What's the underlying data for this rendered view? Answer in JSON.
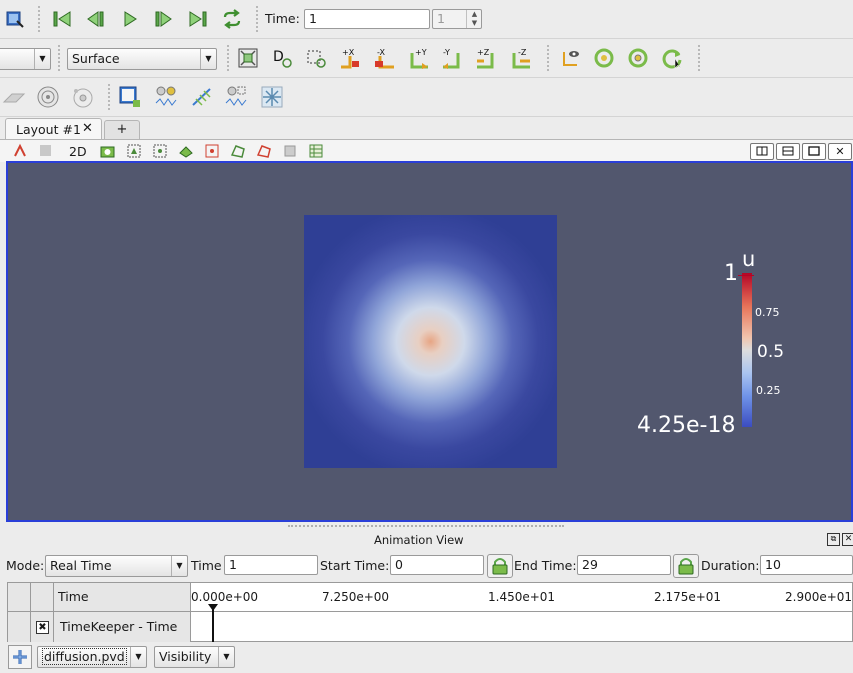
{
  "toolbar_vcr": {
    "time_label": "Time:",
    "time_value": "1",
    "timestep_value": "1"
  },
  "toolbar_representation": {
    "representation": "Surface",
    "camera_labels": [
      "+X",
      "-X",
      "+Y",
      "-Y",
      "+Z",
      "-Z"
    ]
  },
  "tabs": {
    "layout_tab": "Layout #1",
    "add_tab": "+"
  },
  "view_toolbar": {
    "mode_2d": "2D"
  },
  "scalar_bar": {
    "title": "u",
    "max_label": "1",
    "min_label": "4.25e-18",
    "ticks": [
      "0.75",
      "0.5",
      "0.25"
    ],
    "colors": {
      "high": "#b40426",
      "mid": "#dddddd",
      "low": "#3b4cc0"
    }
  },
  "render_view": {
    "background": "#52576e",
    "domain_color": "#2f3f95"
  },
  "animation_view": {
    "title": "Animation View",
    "mode_label": "Mode:",
    "mode_value": "Real Time",
    "time_label": "Time",
    "time_value": "1",
    "start_time_label": "Start Time:",
    "start_time_value": "0",
    "end_time_label": "End Time:",
    "end_time_value": "29",
    "duration_label": "Duration:",
    "duration_value": "10",
    "time_header": "Time",
    "timeline_ticks": [
      "0.000e+00",
      "7.250e+00",
      "1.450e+01",
      "2.175e+01",
      "2.900e+01"
    ],
    "track_name": "TimeKeeper - Time",
    "source_value": "diffusion.pvd",
    "property_value": "Visibility"
  }
}
